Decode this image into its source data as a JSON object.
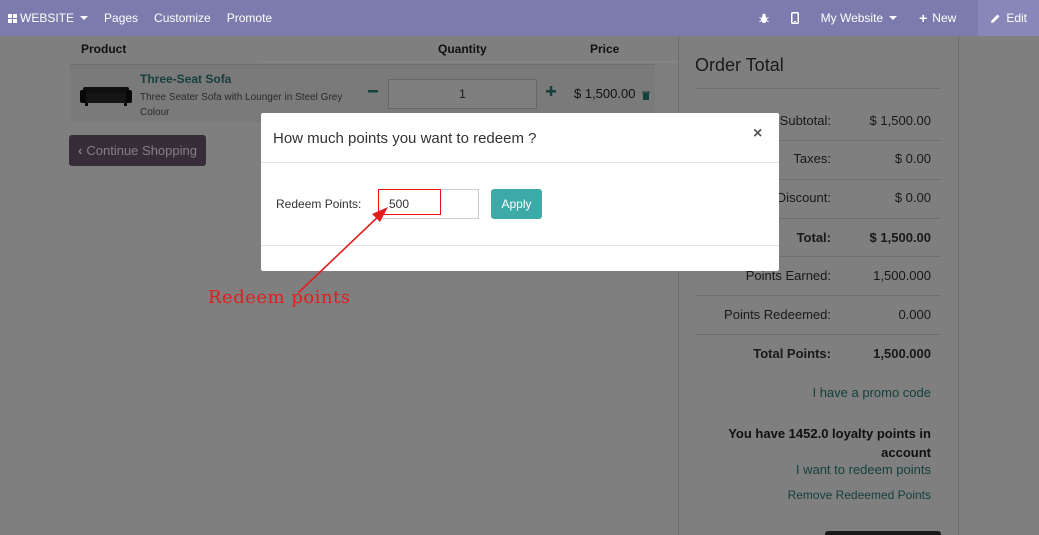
{
  "navbar": {
    "website": "WEBSITE",
    "pages": "Pages",
    "customize": "Customize",
    "promote": "Promote",
    "my_website": "My Website",
    "new": "New",
    "edit": "Edit"
  },
  "cart": {
    "headers": {
      "product": "Product",
      "quantity": "Quantity",
      "price": "Price"
    },
    "item": {
      "name": "Three-Seat Sofa",
      "description": "Three Seater Sofa with Lounger in Steel Grey Colour",
      "quantity": "1",
      "price": "$ 1,500.00"
    },
    "continue_label": "Continue Shopping"
  },
  "order_total": {
    "title": "Order Total",
    "rows": [
      {
        "label": "Subtotal:",
        "value": "$ 1,500.00"
      },
      {
        "label": "Taxes:",
        "value": "$ 0.00"
      },
      {
        "label": "Discount:",
        "value": "$ 0.00"
      },
      {
        "label": "Total:",
        "value": "$ 1,500.00"
      },
      {
        "label": "Points Earned:",
        "value": "1,500.000"
      },
      {
        "label": "Points Redeemed:",
        "value": "0.000"
      },
      {
        "label": "Total Points:",
        "value": "1,500.000"
      }
    ],
    "promo_link": "I have a promo code",
    "loyalty_text": "You have 1452.0 loyalty points in account",
    "redeem_link": "I want to redeem points",
    "remove_link": "Remove Redeemed Points"
  },
  "modal": {
    "title": "How much points you want to redeem ?",
    "close": "×",
    "field_label": "Redeem Points:",
    "field_value": "500",
    "apply_label": "Apply"
  },
  "annotation": {
    "text": "Redeem points",
    "color": "#e01e1e"
  },
  "colors": {
    "navbar": "#7c7bad",
    "accent": "#2c7f7d",
    "apply": "#3eaaa8",
    "continue_button": "#6f5b73"
  }
}
